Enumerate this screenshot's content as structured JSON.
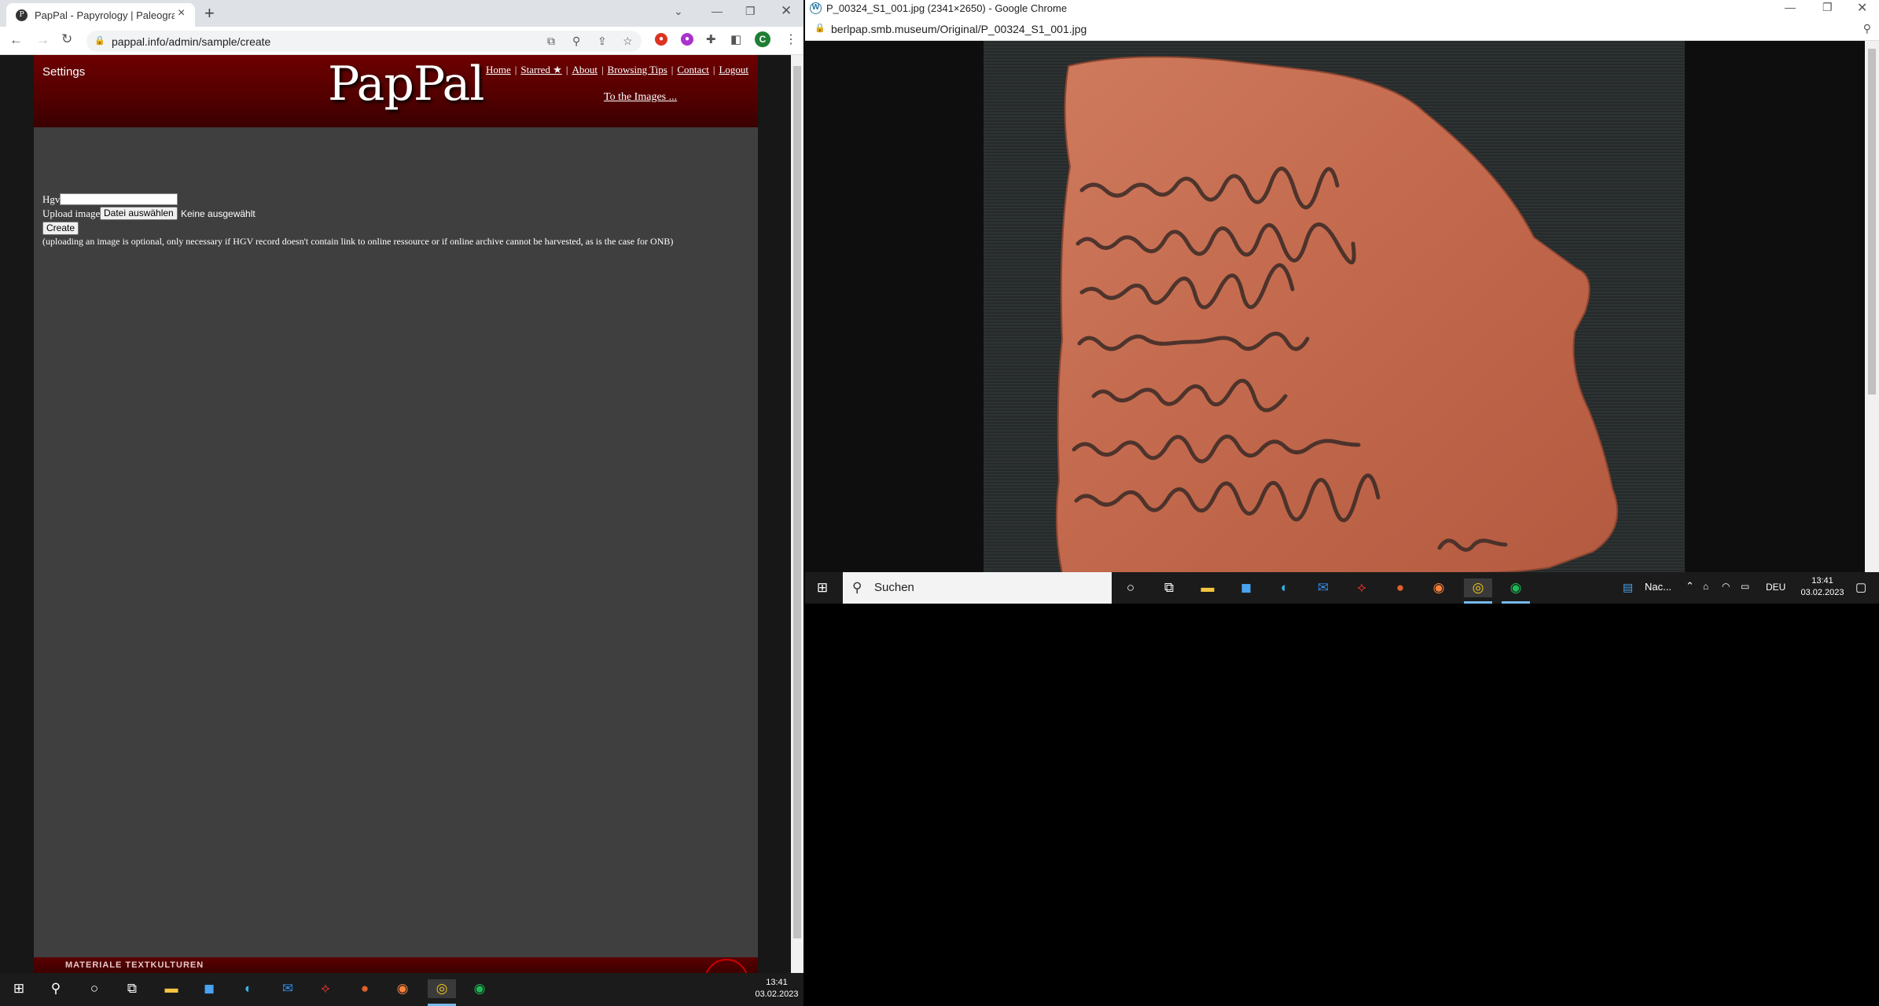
{
  "left_window": {
    "tab_title": "PapPal - Papyrology | Paleograph",
    "new_tab_label": "+",
    "url": "pappal.info/admin/sample/create",
    "site": {
      "settings_label": "Settings",
      "logo": "PapPal",
      "nav": [
        "Home",
        "Starred ★",
        "About",
        "Browsing Tips",
        "Contact",
        "Logout"
      ],
      "to_images_link": "To the Images ...",
      "form": {
        "hgv_label": "Hgv",
        "hgv_value": "",
        "upload_label": "Upload image",
        "file_button": "Datei auswählen",
        "file_status": "Keine ausgewählt",
        "create_button": "Create",
        "note": "(uploading an image is optional, only necessary if HGV record doesn't contain link to online ressource or if online archive cannot be harvested, as is the case for ONB)"
      },
      "footer_text": "MATERIALE TEXTKULTUREN"
    },
    "profile_initial": "C"
  },
  "right_window": {
    "title": "P_00324_S1_001.jpg (2341×2650) - Google Chrome",
    "url": "berlpap.smb.museum/Original/P_00324_S1_001.jpg"
  },
  "right_taskbar": {
    "search_label": "Suchen",
    "widget_label": "Nac...",
    "language": "DEU",
    "time": "13:41",
    "date": "03.02.2023"
  },
  "left_taskbar": {
    "time": "13:41",
    "date": "03.02.2023"
  },
  "colors": {
    "site_header": "#6d0000",
    "site_body": "#3f3f3f",
    "ostracon": "#c2684c",
    "ink": "#3a2a26"
  },
  "icons": [
    "windows-start-icon",
    "search-icon",
    "cortana-icon",
    "task-view-icon",
    "file-explorer-icon",
    "store-icon",
    "edge-icon",
    "mail-icon",
    "acrobat-icon",
    "powerpoint-icon",
    "firefox-icon",
    "chrome-icon",
    "spotify-icon"
  ]
}
